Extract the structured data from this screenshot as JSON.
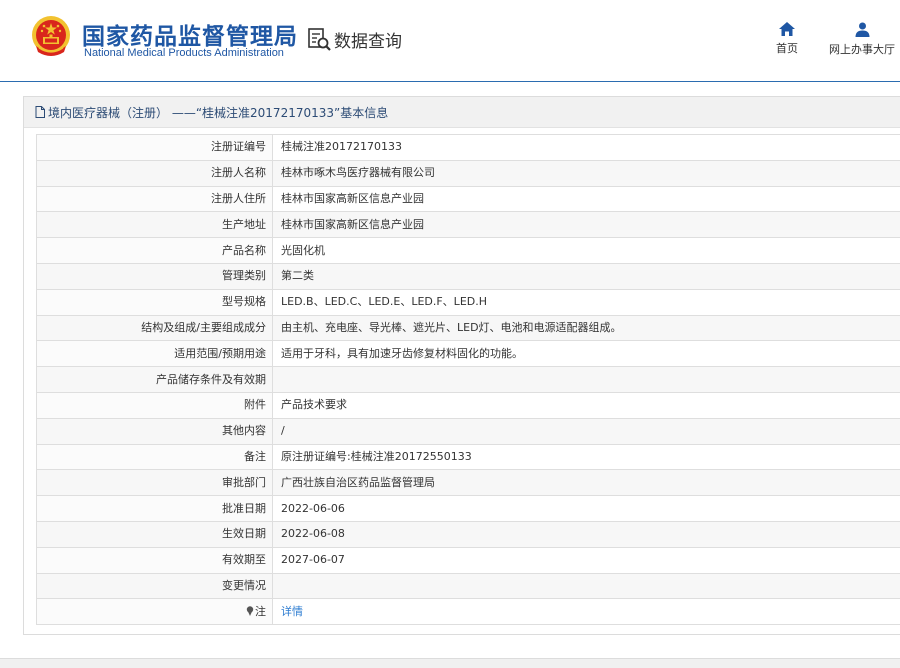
{
  "header": {
    "title_cn": "国家药品监督管理局",
    "title_en": "National Medical Products Administration",
    "search_label": "数据查询",
    "nav": [
      {
        "label": "首页"
      },
      {
        "label": "网上办事大厅"
      }
    ]
  },
  "panel": {
    "title": "境内医疗器械（注册） ——“桂械注准20172170133”基本信息"
  },
  "rows": [
    {
      "label": "注册证编号",
      "value": "桂械注准20172170133"
    },
    {
      "label": "注册人名称",
      "value": "桂林市啄木鸟医疗器械有限公司"
    },
    {
      "label": "注册人住所",
      "value": "桂林市国家高新区信息产业园"
    },
    {
      "label": "生产地址",
      "value": "桂林市国家高新区信息产业园"
    },
    {
      "label": "产品名称",
      "value": "光固化机"
    },
    {
      "label": "管理类别",
      "value": "第二类"
    },
    {
      "label": "型号规格",
      "value": "LED.B、LED.C、LED.E、LED.F、LED.H"
    },
    {
      "label": "结构及组成/主要组成成分",
      "value": "由主机、充电座、导光棒、遮光片、LED灯、电池和电源适配器组成。"
    },
    {
      "label": "适用范围/预期用途",
      "value": "适用于牙科，具有加速牙齿修复材料固化的功能。"
    },
    {
      "label": "产品储存条件及有效期",
      "value": ""
    },
    {
      "label": "附件",
      "value": "产品技术要求"
    },
    {
      "label": "其他内容",
      "value": "/"
    },
    {
      "label": "备注",
      "value": "原注册证编号:桂械注准20172550133"
    },
    {
      "label": "审批部门",
      "value": "广西壮族自治区药品监督管理局"
    },
    {
      "label": "批准日期",
      "value": "2022-06-06"
    },
    {
      "label": "生效日期",
      "value": "2022-06-08"
    },
    {
      "label": "有效期至",
      "value": "2027-06-07"
    },
    {
      "label": "变更情况",
      "value": ""
    }
  ],
  "note_row": {
    "label": "注",
    "link_label": "详情"
  },
  "colors": {
    "brand_blue": "#1f57a4",
    "link_blue": "#2b7bd0",
    "emblem_red": "#d9261c",
    "emblem_gold": "#f2c230"
  }
}
